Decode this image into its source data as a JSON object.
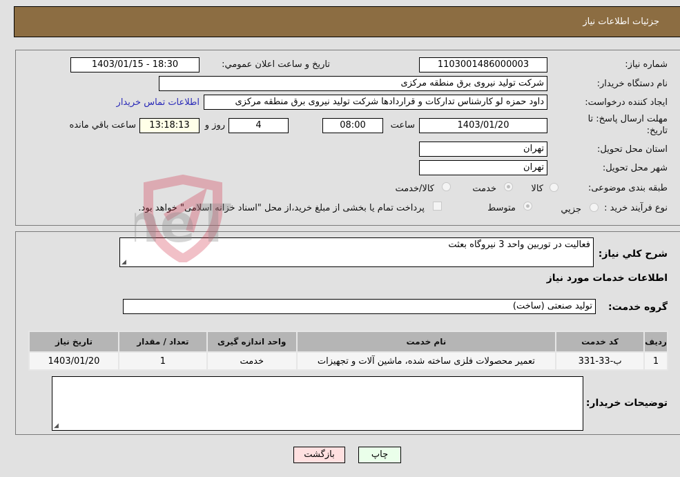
{
  "header": {
    "title": "جزئیات اطلاعات نیاز"
  },
  "form": {
    "need_number_label": "شماره نیاز:",
    "need_number": "1103001486000003",
    "announce_label": "تاریخ و ساعت اعلان عمومي:",
    "announce_value": "1403/01/15 - 18:30",
    "buyer_org_label": "نام دستگاه خریدار:",
    "buyer_org": "شرکت تولید نیروی برق منطقه مرکزی",
    "creator_label": "ایجاد کننده درخواست:",
    "creator": "داود حمزه لو کارشناس تدارکات و قراردادها شرکت تولید نیروی برق منطقه مرکزی",
    "contact_link": "اطلاعات تماس خریدار",
    "deadline_label_line1": "مهلت ارسال پاسخ: تا",
    "deadline_label_line2": "تاریخ:",
    "deadline_date": "1403/01/20",
    "time_label": "ساعت",
    "deadline_time": "08:00",
    "days_value": "4",
    "days_label": "روز و",
    "remaining_time": "13:18:13",
    "remaining_label": "ساعت باقي مانده",
    "province_label": "استان محل تحویل:",
    "province": "تهران",
    "city_label": "شهر محل تحویل:",
    "city": "تهران",
    "category_label": "طبقه بندی موضوعی:",
    "category_options": [
      "کالا",
      "خدمت",
      "کالا/خدمت"
    ],
    "category_selected": "خدمت",
    "process_label": "نوع فرآیند خرید :",
    "process_options": [
      "جزيي",
      "متوسط"
    ],
    "process_selected": "متوسط",
    "treasury_note": "پرداخت تمام یا بخشی از مبلغ خرید،از محل \"اسناد خزانه اسلامی\" خواهد بود."
  },
  "details": {
    "summary_label": "شرح کلي نیاز:",
    "summary": "فعالیت در توربین واحد 3 نیروگاه بعثت",
    "services_heading": "اطلاعات خدمات مورد نیاز",
    "service_group_label": "گروه خدمت:",
    "service_group": "تولید صنعتی (ساخت)",
    "table": {
      "headers": [
        "ردیف",
        "کد خدمت",
        "نام خدمت",
        "واحد اندازه گیری",
        "تعداد / مقدار",
        "تاریخ نیاز"
      ],
      "rows": [
        [
          "1",
          "ب-33-331",
          "تعمیر محصولات فلزی ساخته شده، ماشین آلات و تجهیزات",
          "خدمت",
          "1",
          "1403/01/20"
        ]
      ]
    },
    "buyer_notes_label": "توضیحات خریدار:",
    "buyer_notes": ""
  },
  "buttons": {
    "print": "چاپ",
    "back": "بازگشت"
  },
  "watermark": {
    "text": "AriaTender.neT"
  }
}
